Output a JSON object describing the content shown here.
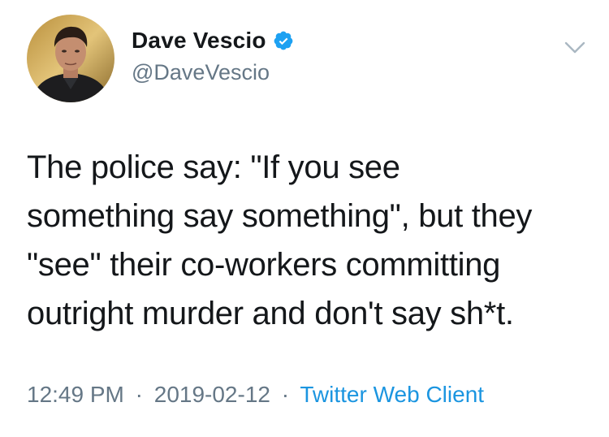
{
  "tweet": {
    "author": {
      "display_name": "Dave Vescio",
      "handle": "@DaveVescio",
      "verified": true,
      "avatar_icon": "profile-photo"
    },
    "menu_icon": "chevron-down-icon",
    "text": "The police say: \"If you see\nsomething say something\", but they\n\"see\" their co-workers committing\noutright murder and don't say sh*t.",
    "timestamp": {
      "time": "12:49 PM",
      "separator_1": "·",
      "date": "2019-02-12",
      "separator_2": "·",
      "client": "Twitter Web Client"
    },
    "colors": {
      "verified_badge": "#1da1f2",
      "link": "#1b95e0",
      "secondary_text": "#657786",
      "primary_text": "#14171a"
    }
  }
}
